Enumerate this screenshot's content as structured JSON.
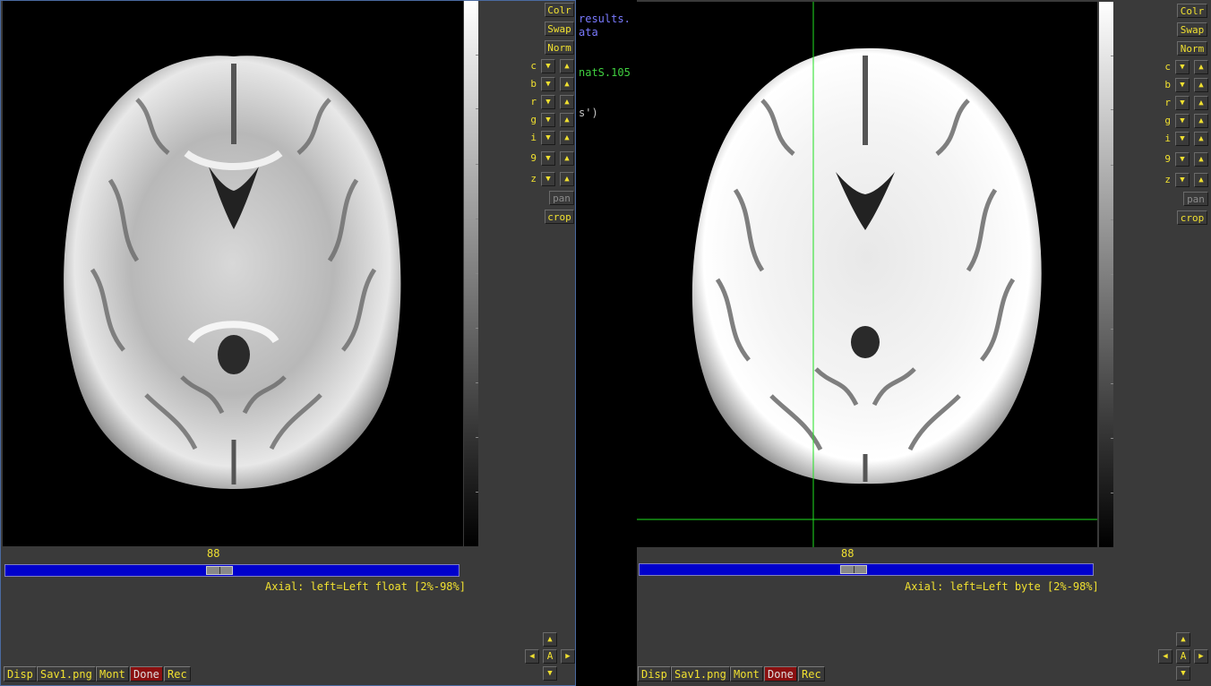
{
  "terminal": {
    "lines": [
      {
        "text": "results.",
        "color": "#7a7aff"
      },
      {
        "text": "ata",
        "color": "#7a7aff"
      },
      {
        "text": "natS.105",
        "color": "#40d040"
      },
      {
        "text": "s')",
        "color": "#c8c8c8"
      }
    ]
  },
  "left_viewer": {
    "buttons": {
      "colr": "Colr",
      "swap": "Swap",
      "norm": "Norm",
      "pan": "pan",
      "crop": "crop"
    },
    "rows": [
      "c",
      "b",
      "r",
      "g",
      "i",
      "9",
      "z"
    ],
    "slice_value": "88",
    "slider_fraction": 0.47,
    "info": "Axial: left=Left float [2%-98%]",
    "bottom": {
      "disp": "Disp",
      "save": "Sav1.png",
      "mont": "Mont",
      "done": "Done",
      "rec": "Rec"
    },
    "nav_center": "A"
  },
  "right_viewer": {
    "buttons": {
      "colr": "Colr",
      "swap": "Swap",
      "norm": "Norm",
      "pan": "pan",
      "crop": "crop"
    },
    "rows": [
      "c",
      "b",
      "r",
      "g",
      "i",
      "9",
      "z"
    ],
    "slice_value": "88",
    "slider_fraction": 0.47,
    "info": "Axial: left=Left byte [2%-98%]",
    "bottom": {
      "disp": "Disp",
      "save": "Sav1.png",
      "mont": "Mont",
      "done": "Done",
      "rec": "Rec"
    },
    "nav_center": "A",
    "crosshair_color": "#20e020"
  }
}
